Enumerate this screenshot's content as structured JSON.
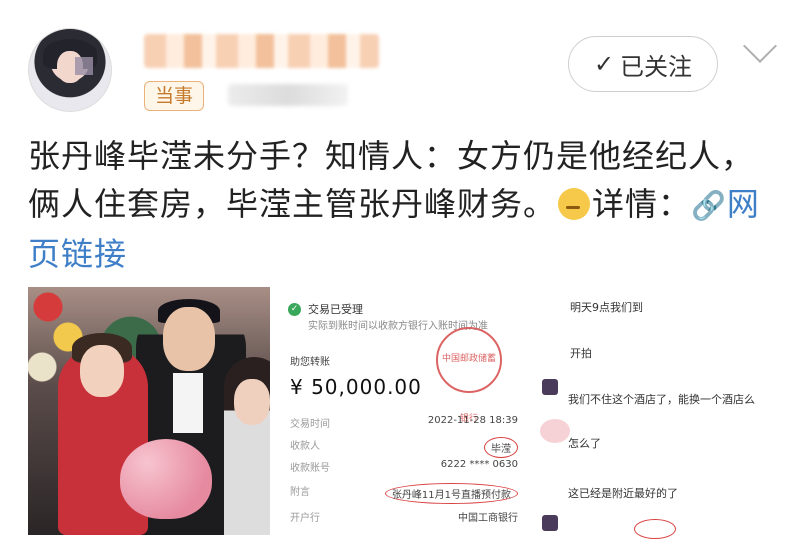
{
  "header": {
    "tag": "当事",
    "follow_label": "已关注",
    "follow_icon": "check-icon",
    "menu_icon": "chevron-down-icon"
  },
  "post": {
    "text": "张丹峰毕滢未分手？知情人：女方仍是他经纪人，俩人住套房，毕滢主管张丹峰财务。",
    "emoji": "smirk-face",
    "detail_label": "详情：",
    "link_icon": "link-icon",
    "link_text": "网页链接"
  },
  "receipt": {
    "status": "交易已受理",
    "note": "实际到账时间以收款方银行入账时间为准",
    "type": "助您转账",
    "amount": "¥ 50,000.00",
    "stamp": "中国邮政储蓄银行",
    "rows": [
      {
        "key": "交易时间",
        "value": "2022-11-28 18:39"
      },
      {
        "key": "收款人",
        "value": "毕滢"
      },
      {
        "key": "收款账号",
        "value": "6222 **** 0630"
      },
      {
        "key": "附言",
        "value": "张丹峰11月1号直播预付款"
      },
      {
        "key": "开户行",
        "value": "中国工商银行"
      }
    ]
  },
  "chat": {
    "messages": [
      {
        "text": "明天9点我们到"
      },
      {
        "text": "开拍"
      },
      {
        "text": "我们不住这个酒店了，能换一个酒店么"
      },
      {
        "text": "怎么了"
      },
      {
        "text": "这已经是附近最好的了"
      }
    ]
  }
}
